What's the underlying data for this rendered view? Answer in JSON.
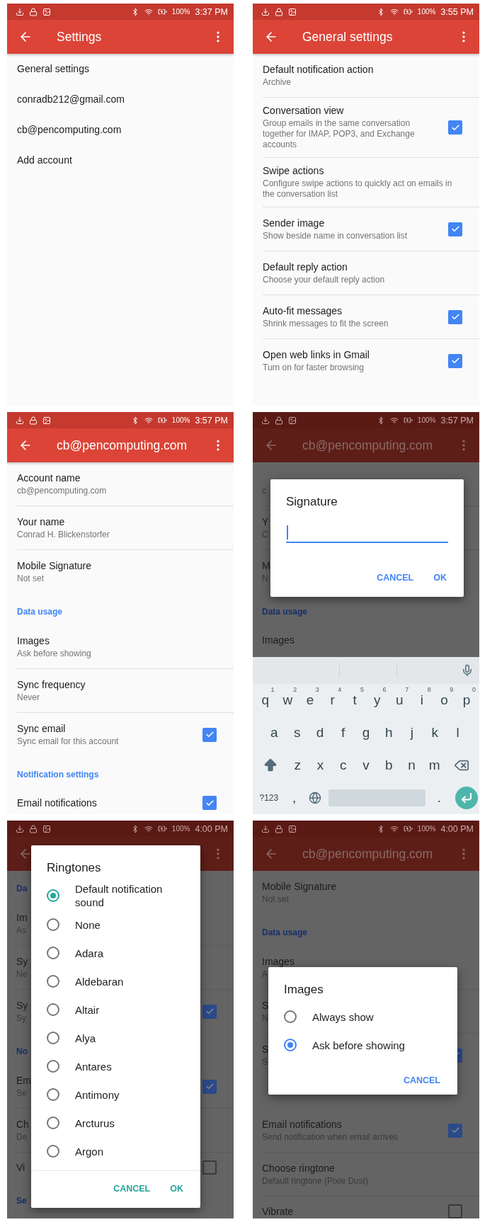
{
  "screens": [
    {
      "dimmed": false,
      "status": {
        "battery": "100%",
        "time": "3:37 PM"
      },
      "app_bar": {
        "title": "Settings"
      },
      "items": [
        {
          "kind": "row",
          "title": "General settings"
        },
        {
          "kind": "row",
          "title": "conradb212@gmail.com"
        },
        {
          "kind": "row",
          "title": "cb@pencomputing.com"
        },
        {
          "kind": "row",
          "title": "Add account"
        }
      ]
    },
    {
      "dimmed": false,
      "status": {
        "battery": "100%",
        "time": "3:55 PM"
      },
      "app_bar": {
        "title": "General settings"
      },
      "items": [
        {
          "kind": "row",
          "title": "Default notification action",
          "subtitle": "Archive"
        },
        {
          "kind": "row",
          "title": "Conversation view",
          "subtitle": "Group emails in the same conversation together for IMAP, POP3, and Exchange accounts",
          "checked": true
        },
        {
          "kind": "row",
          "title": "Swipe actions",
          "subtitle": "Configure swipe actions to quickly act on emails in the conversation list"
        },
        {
          "kind": "row",
          "title": "Sender image",
          "subtitle": "Show beside name in conversation list",
          "checked": true
        },
        {
          "kind": "row",
          "title": "Default reply action",
          "subtitle": "Choose your default reply action"
        },
        {
          "kind": "row",
          "title": "Auto-fit messages",
          "subtitle": "Shrink messages to fit the screen",
          "checked": true
        },
        {
          "kind": "row",
          "title": "Open web links in Gmail",
          "subtitle": "Turn on for faster browsing",
          "checked": true
        }
      ]
    },
    {
      "dimmed": false,
      "status": {
        "battery": "100%",
        "time": "3:57 PM"
      },
      "app_bar": {
        "title": "cb@pencomputing.com"
      },
      "items": [
        {
          "kind": "row",
          "title": "Account name",
          "subtitle": "cb@pencomputing.com"
        },
        {
          "kind": "row",
          "title": "Your name",
          "subtitle": "Conrad H. Blickenstorfer"
        },
        {
          "kind": "row",
          "title": "Mobile Signature",
          "subtitle": "Not set"
        },
        {
          "kind": "section",
          "label": "Data usage"
        },
        {
          "kind": "row",
          "title": "Images",
          "subtitle": "Ask before showing"
        },
        {
          "kind": "row",
          "title": "Sync frequency",
          "subtitle": "Never"
        },
        {
          "kind": "row",
          "title": "Sync email",
          "subtitle": "Sync email for this account",
          "checked": true
        },
        {
          "kind": "section",
          "label": "Notification settings"
        },
        {
          "kind": "row",
          "title": "Email notifications",
          "checked": true
        }
      ]
    },
    {
      "dimmed": true,
      "status": {
        "battery": "100%",
        "time": "3:57 PM"
      },
      "app_bar": {
        "title": "cb@pencomputing.com"
      },
      "items": [
        {
          "kind": "row",
          "subtitle": "c"
        },
        {
          "kind": "row",
          "title": "Y",
          "subtitle": "C"
        },
        {
          "kind": "row",
          "title": "M",
          "subtitle": "N"
        },
        {
          "kind": "section",
          "label": "Data usage"
        },
        {
          "kind": "row",
          "title": "Images"
        }
      ],
      "dialog": {
        "kind": "signature",
        "title": "Signature",
        "field": {
          "focused": true
        },
        "buttons": [
          "CANCEL",
          "OK"
        ]
      },
      "keyboard": {
        "rows": [
          [
            {
              "kind": "char",
              "key": "q",
              "hint": "1"
            },
            {
              "kind": "char",
              "key": "w",
              "hint": "2"
            },
            {
              "kind": "char",
              "key": "e",
              "hint": "3"
            },
            {
              "kind": "char",
              "key": "r",
              "hint": "4"
            },
            {
              "kind": "char",
              "key": "t",
              "hint": "5"
            },
            {
              "kind": "char",
              "key": "y",
              "hint": "6"
            },
            {
              "kind": "char",
              "key": "u",
              "hint": "7"
            },
            {
              "kind": "char",
              "key": "i",
              "hint": "8"
            },
            {
              "kind": "char",
              "key": "o",
              "hint": "9"
            },
            {
              "kind": "char",
              "key": "p",
              "hint": "0"
            }
          ],
          [
            {
              "kind": "char",
              "key": "a"
            },
            {
              "kind": "char",
              "key": "s"
            },
            {
              "kind": "char",
              "key": "d"
            },
            {
              "kind": "char",
              "key": "f"
            },
            {
              "kind": "char",
              "key": "g"
            },
            {
              "kind": "char",
              "key": "h"
            },
            {
              "kind": "char",
              "key": "j"
            },
            {
              "kind": "char",
              "key": "k"
            },
            {
              "kind": "char",
              "key": "l"
            }
          ],
          [
            {
              "kind": "shift"
            },
            {
              "kind": "char",
              "key": "z"
            },
            {
              "kind": "char",
              "key": "x"
            },
            {
              "kind": "char",
              "key": "c"
            },
            {
              "kind": "char",
              "key": "v"
            },
            {
              "kind": "char",
              "key": "b"
            },
            {
              "kind": "char",
              "key": "n"
            },
            {
              "kind": "char",
              "key": "m"
            },
            {
              "kind": "backspace"
            }
          ],
          [
            {
              "kind": "symbols",
              "key": "?123"
            },
            {
              "kind": "char",
              "key": ","
            },
            {
              "kind": "globe"
            },
            {
              "kind": "space"
            },
            {
              "kind": "char",
              "key": "."
            },
            {
              "kind": "enter"
            }
          ]
        ]
      }
    },
    {
      "dimmed": true,
      "status": {
        "battery": "100%",
        "time": "4:00 PM"
      },
      "items": [
        {
          "kind": "section",
          "label": "Da"
        },
        {
          "kind": "row",
          "title": "Im",
          "subtitle": "As"
        },
        {
          "kind": "row",
          "title": "Sy",
          "subtitle": "Ne"
        },
        {
          "kind": "row",
          "title": "Sy",
          "subtitle": "Sy",
          "checked": true
        },
        {
          "kind": "section",
          "label": "No"
        },
        {
          "kind": "row",
          "title": "Em",
          "subtitle": "Se",
          "checked": true
        },
        {
          "kind": "row",
          "title": "Ch",
          "subtitle": "De"
        },
        {
          "kind": "row",
          "title": "Vi",
          "checked": false
        },
        {
          "kind": "section",
          "label": "Se"
        }
      ],
      "dialog": {
        "kind": "ringtones",
        "title": "Ringtones",
        "options": [
          {
            "label": "Default notification sound",
            "selected": true
          },
          {
            "label": "None",
            "selected": false
          },
          {
            "label": "Adara",
            "selected": false
          },
          {
            "label": "Aldebaran",
            "selected": false
          },
          {
            "label": "Altair",
            "selected": false
          },
          {
            "label": "Alya",
            "selected": false
          },
          {
            "label": "Antares",
            "selected": false
          },
          {
            "label": "Antimony",
            "selected": false
          },
          {
            "label": "Arcturus",
            "selected": false
          },
          {
            "label": "Argon",
            "selected": false
          }
        ],
        "buttons": [
          "CANCEL",
          "OK"
        ]
      }
    },
    {
      "dimmed": true,
      "status": {
        "battery": "100%",
        "time": "4:00 PM"
      },
      "app_bar": {
        "title": "cb@pencomputing.com"
      },
      "items": [
        {
          "kind": "row",
          "title": "Mobile Signature",
          "subtitle": "Not set"
        },
        {
          "kind": "section",
          "label": "Data usage"
        },
        {
          "kind": "row",
          "title": "Images",
          "subtitle": "A"
        },
        {
          "kind": "row",
          "title": "S",
          "subtitle": "N"
        },
        {
          "kind": "row",
          "title": "S",
          "subtitle": "S",
          "checked": true
        },
        {
          "kind": "section"
        },
        {
          "kind": "row",
          "title": "Email notifications",
          "subtitle": "Send notification when email arrives",
          "checked": true
        },
        {
          "kind": "row",
          "title": "Choose ringtone",
          "subtitle": "Default ringtone (Pixie Dust)"
        },
        {
          "kind": "row",
          "title": "Vibrate",
          "checked": false
        }
      ],
      "dialog": {
        "kind": "choice",
        "title": "Images",
        "options": [
          {
            "label": "Always show",
            "selected": false
          },
          {
            "label": "Ask before showing",
            "selected": true
          }
        ],
        "buttons": [
          "CANCEL"
        ]
      }
    }
  ]
}
